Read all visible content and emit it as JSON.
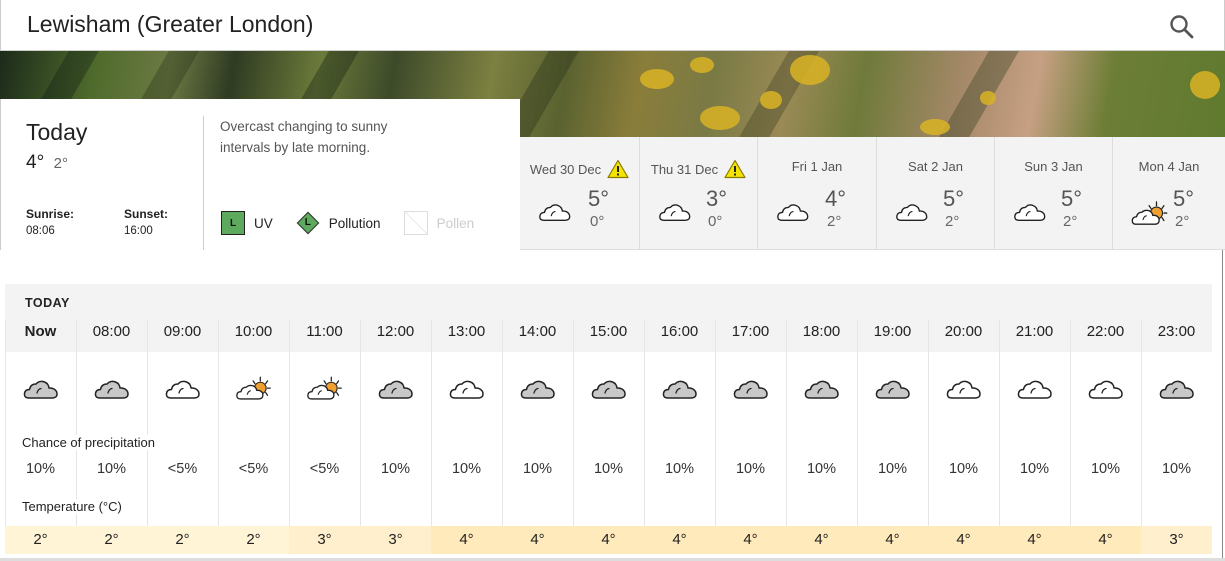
{
  "header": {
    "title": "Lewisham (Greater London)",
    "search_icon": "search-icon"
  },
  "today": {
    "label": "Today",
    "high": "4°",
    "low": "2°",
    "sunrise_label": "Sunrise:",
    "sunrise": "08:06",
    "sunset_label": "Sunset:",
    "sunset": "16:00",
    "summary": "Overcast changing to sunny intervals by late morning.",
    "indicators": {
      "uv": {
        "level": "L",
        "label": "UV",
        "color": "#5daa5e"
      },
      "pollution": {
        "level": "L",
        "label": "Pollution",
        "color": "#5daa5e"
      },
      "pollen": {
        "label": "Pollen",
        "available": false
      }
    }
  },
  "days": [
    {
      "name": "Wed 30 Dec",
      "warning": true,
      "icon": "cloud",
      "high": "5°",
      "low": "0°"
    },
    {
      "name": "Thu 31 Dec",
      "warning": true,
      "icon": "cloud",
      "high": "3°",
      "low": "0°"
    },
    {
      "name": "Fri 1 Jan",
      "warning": false,
      "icon": "cloud",
      "high": "4°",
      "low": "2°"
    },
    {
      "name": "Sat 2 Jan",
      "warning": false,
      "icon": "cloud",
      "high": "5°",
      "low": "2°"
    },
    {
      "name": "Sun 3 Jan",
      "warning": false,
      "icon": "cloud",
      "high": "5°",
      "low": "2°"
    },
    {
      "name": "Mon 4 Jan",
      "warning": false,
      "icon": "sun-cloud",
      "high": "5°",
      "low": "2°"
    }
  ],
  "hourly": {
    "title": "TODAY",
    "precip_label": "Chance of precipitation",
    "temp_label": "Temperature (°C)",
    "hours": [
      {
        "time": "Now",
        "icon": "grey-cloud",
        "precip": "10%",
        "temp": "2°"
      },
      {
        "time": "08:00",
        "icon": "grey-cloud",
        "precip": "10%",
        "temp": "2°"
      },
      {
        "time": "09:00",
        "icon": "white-cloud",
        "precip": "<5%",
        "temp": "2°"
      },
      {
        "time": "10:00",
        "icon": "sun-cloud",
        "precip": "<5%",
        "temp": "2°"
      },
      {
        "time": "11:00",
        "icon": "sun-cloud",
        "precip": "<5%",
        "temp": "3°"
      },
      {
        "time": "12:00",
        "icon": "grey-cloud",
        "precip": "10%",
        "temp": "3°"
      },
      {
        "time": "13:00",
        "icon": "white-cloud",
        "precip": "10%",
        "temp": "4°"
      },
      {
        "time": "14:00",
        "icon": "grey-cloud",
        "precip": "10%",
        "temp": "4°"
      },
      {
        "time": "15:00",
        "icon": "grey-cloud",
        "precip": "10%",
        "temp": "4°"
      },
      {
        "time": "16:00",
        "icon": "grey-cloud",
        "precip": "10%",
        "temp": "4°"
      },
      {
        "time": "17:00",
        "icon": "grey-cloud",
        "precip": "10%",
        "temp": "4°"
      },
      {
        "time": "18:00",
        "icon": "grey-cloud",
        "precip": "10%",
        "temp": "4°"
      },
      {
        "time": "19:00",
        "icon": "grey-cloud",
        "precip": "10%",
        "temp": "4°"
      },
      {
        "time": "20:00",
        "icon": "white-cloud",
        "precip": "10%",
        "temp": "4°"
      },
      {
        "time": "21:00",
        "icon": "white-cloud",
        "precip": "10%",
        "temp": "4°"
      },
      {
        "time": "22:00",
        "icon": "white-cloud",
        "precip": "10%",
        "temp": "4°"
      },
      {
        "time": "23:00",
        "icon": "grey-cloud",
        "precip": "10%",
        "temp": "3°"
      }
    ]
  },
  "colors": {
    "temp_2": "#fff4d6",
    "temp_3": "#ffefcc",
    "temp_4": "#ffeabb",
    "sun": "#f0a030",
    "warning": "#f5e400"
  }
}
